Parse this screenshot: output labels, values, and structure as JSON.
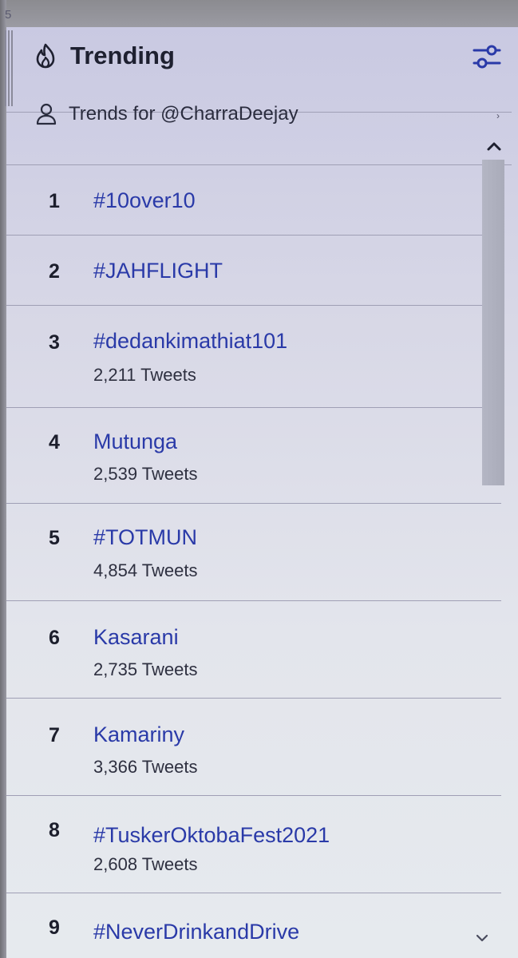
{
  "tab": {
    "number": "5"
  },
  "header": {
    "title": "Trending",
    "flame_icon": "flame-icon",
    "filter_icon": "sliders-icon"
  },
  "trends_for": {
    "label": "Trends for @CharraDeejay",
    "icon": "person-icon"
  },
  "colors": {
    "trend_link": "#2a3aa8",
    "header_bg": "#c9c9e2",
    "text_dark": "#1e2030"
  },
  "trends": [
    {
      "rank": "1",
      "name": "#10over10",
      "count": ""
    },
    {
      "rank": "2",
      "name": "#JAHFLIGHT",
      "count": ""
    },
    {
      "rank": "3",
      "name": "#dedankimathiat101",
      "count": "2,211 Tweets"
    },
    {
      "rank": "4",
      "name": "Mutunga",
      "count": "2,539 Tweets"
    },
    {
      "rank": "5",
      "name": "#TOTMUN",
      "count": "4,854 Tweets"
    },
    {
      "rank": "6",
      "name": "Kasarani",
      "count": "2,735 Tweets"
    },
    {
      "rank": "7",
      "name": "Kamariny",
      "count": "3,366 Tweets"
    },
    {
      "rank": "8",
      "name": "#TuskerOktobaFest2021",
      "count": "2,608 Tweets"
    },
    {
      "rank": "9",
      "name": "#NeverDrinkandDrive",
      "count": ""
    }
  ]
}
